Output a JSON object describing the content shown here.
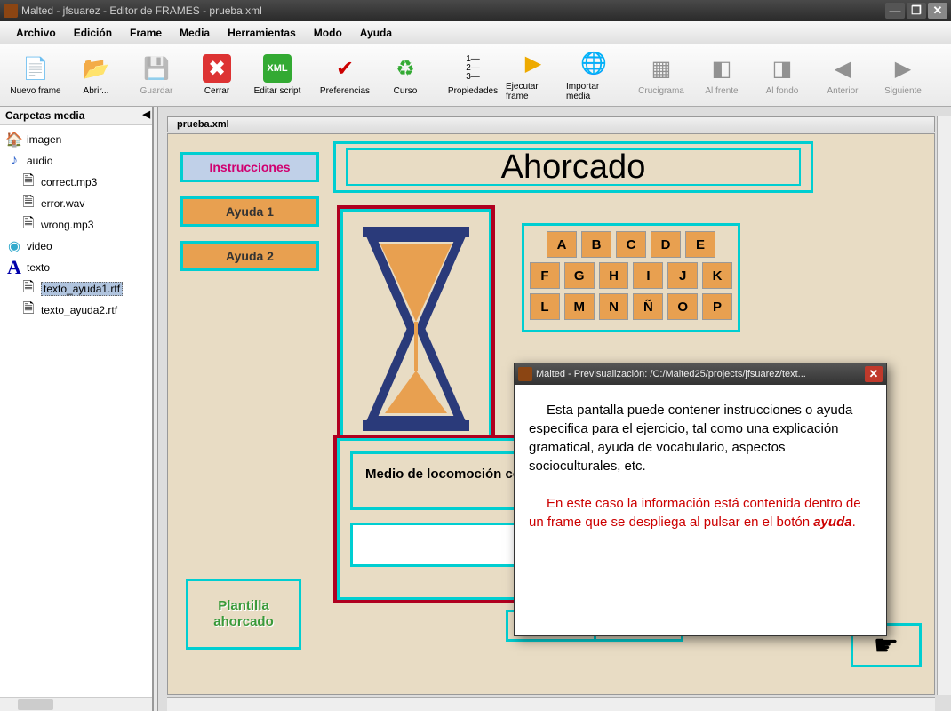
{
  "titlebar": {
    "title": "Malted - jfsuarez - Editor de FRAMES - prueba.xml"
  },
  "menu": {
    "items": [
      "Archivo",
      "Edición",
      "Frame",
      "Media",
      "Herramientas",
      "Modo",
      "Ayuda"
    ]
  },
  "toolbar": {
    "nuevo": "Nuevo frame",
    "abrir": "Abrir...",
    "guardar": "Guardar",
    "cerrar": "Cerrar",
    "editar_script": "Editar script",
    "preferencias": "Preferencias",
    "curso": "Curso",
    "propiedades": "Propiedades",
    "ejecutar": "Ejecutar frame",
    "importar": "Importar media",
    "crucigrama": "Crucigrama",
    "al_frente": "Al frente",
    "al_fondo": "Al fondo",
    "anterior": "Anterior",
    "siguiente": "Siguiente"
  },
  "sidebar": {
    "header": "Carpetas media",
    "imagen": "imagen",
    "audio": "audio",
    "audio_files": [
      "correct.mp3",
      "error.wav",
      "wrong.mp3"
    ],
    "video": "video",
    "texto": "texto",
    "texto_files": [
      "texto_ayuda1.rtf",
      "texto_ayuda2.rtf"
    ],
    "selected": "texto_ayuda1.rtf"
  },
  "canvas": {
    "tab": "prueba.xml",
    "instrucciones": "Instrucciones",
    "ayuda1": "Ayuda 1",
    "ayuda2": "Ayuda 2",
    "title": "Ahorcado",
    "alphabet": [
      [
        "A",
        "B",
        "C",
        "D",
        "E"
      ],
      [
        "F",
        "G",
        "H",
        "I",
        "J",
        "K"
      ],
      [
        "L",
        "M",
        "N",
        "Ñ",
        "O",
        "P"
      ]
    ],
    "clue": "Medio de locomoción con tracción humana",
    "plantilla_l1": "Plantilla",
    "plantilla_l2": "ahorcado"
  },
  "dialog": {
    "title": "Malted - Previsualización: /C:/Malted25/projects/jfsuarez/text...",
    "para1": "Esta pantalla puede contener instrucciones o ayuda especifica para el ejercicio, tal como una explicación gramatical, ayuda de vocabulario, aspectos socioculturales, etc.",
    "para2a": "En este caso la información está contenida dentro de un frame que se despliega al pulsar en el botón ",
    "para2b": "ayuda",
    "para2c": "."
  }
}
